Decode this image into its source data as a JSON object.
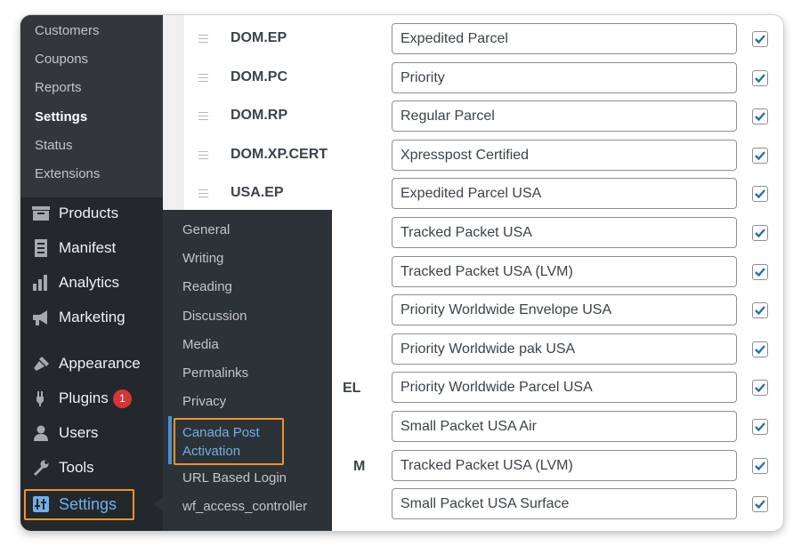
{
  "settings_submenu": {
    "items": [
      "Customers",
      "Coupons",
      "Reports",
      "Settings",
      "Status",
      "Extensions"
    ],
    "current": "Settings"
  },
  "admin_menu": {
    "items": [
      {
        "label": "Products",
        "icon": "archive-icon"
      },
      {
        "label": "Manifest",
        "icon": "document-icon"
      },
      {
        "label": "Analytics",
        "icon": "bar-chart-icon"
      },
      {
        "label": "Marketing",
        "icon": "megaphone-icon"
      },
      {
        "label": "Appearance",
        "icon": "paintbrush-icon"
      },
      {
        "label": "Plugins",
        "icon": "plug-icon",
        "badge": "1"
      },
      {
        "label": "Users",
        "icon": "user-icon"
      },
      {
        "label": "Tools",
        "icon": "wrench-icon"
      },
      {
        "label": "Settings",
        "icon": "settings-sliders-icon"
      }
    ]
  },
  "flyout": {
    "items": [
      "General",
      "Writing",
      "Reading",
      "Discussion",
      "Media",
      "Permalinks",
      "Privacy"
    ],
    "highlighted": [
      "Canada Post",
      "Activation"
    ],
    "after": [
      "URL Based Login",
      "wf_access_controller"
    ]
  },
  "services": [
    {
      "code": "DOM.EP",
      "name": "Expedited Parcel",
      "enabled": true
    },
    {
      "code": "DOM.PC",
      "name": "Priority",
      "enabled": true
    },
    {
      "code": "DOM.RP",
      "name": "Regular Parcel",
      "enabled": true
    },
    {
      "code": "DOM.XP.CERT",
      "name": "Xpresspost Certified",
      "enabled": true
    },
    {
      "code": "USA.EP",
      "name": "Expedited Parcel USA",
      "enabled": true
    },
    {
      "code": "",
      "name": "Tracked Packet USA",
      "enabled": true
    },
    {
      "code": "",
      "name": "Tracked Packet USA (LVM)",
      "enabled": true
    },
    {
      "code": "",
      "name": "Priority Worldwide Envelope USA",
      "enabled": true
    },
    {
      "code": "",
      "name": "Priority Worldwide pak USA",
      "enabled": true
    },
    {
      "code": "EL",
      "name": "Priority Worldwide Parcel USA",
      "enabled": true
    },
    {
      "code": "",
      "name": "Small Packet USA Air",
      "enabled": true
    },
    {
      "code": "M",
      "name": "Tracked Packet USA (LVM)",
      "enabled": true
    },
    {
      "code": "",
      "name": "Small Packet USA Surface",
      "enabled": true
    }
  ],
  "colors": {
    "sidebar_bg": "#23282d",
    "submenu_bg": "#32373c",
    "flyout_bg": "#2c3338",
    "accent_blue": "#72aee6",
    "checkbox_check": "#2271b1",
    "highlight_orange": "#f0922a",
    "badge_red": "#d63638"
  }
}
